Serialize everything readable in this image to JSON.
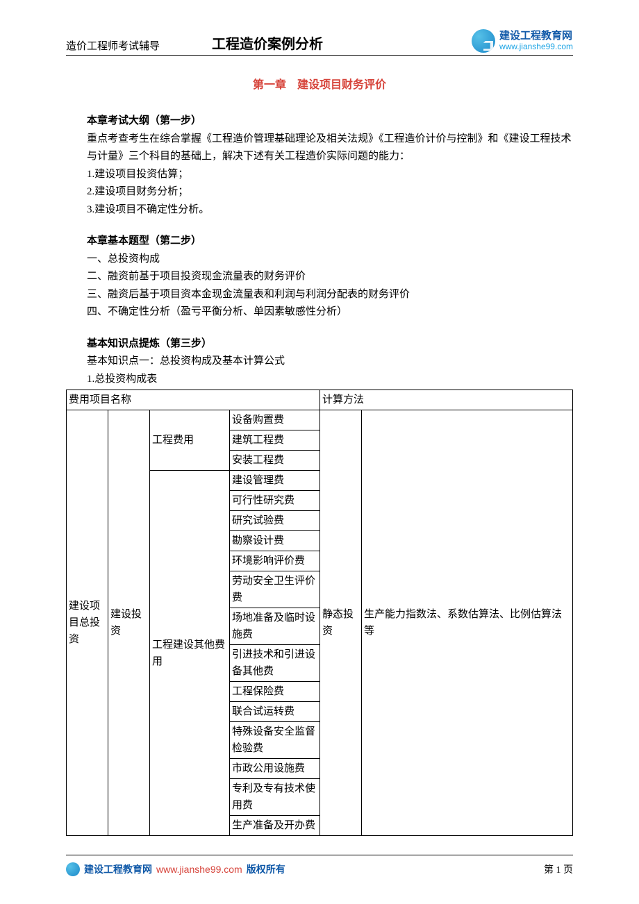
{
  "header": {
    "left": "造价工程师考试辅导",
    "center": "工程造价案例分析",
    "logo_cn": "建设工程教育网",
    "logo_url": "www.jianshe99.com"
  },
  "chapter_title": "第一章　建设项目财务评价",
  "sec1": {
    "head": "本章考试大纲（第一步）",
    "intro": "重点考查考生在综合掌握《工程造价管理基础理论及相关法规》《工程造价计价与控制》和《建设工程技术与计量》三个科目的基础上，解决下述有关工程造价实际问题的能力：",
    "i1": "1.建设项目投资估算；",
    "i2": "2.建设项目财务分析；",
    "i3": "3.建设项目不确定性分析。"
  },
  "sec2": {
    "head": "本章基本题型（第二步）",
    "i1": "一、总投资构成",
    "i2": "二、融资前基于项目投资现金流量表的财务评价",
    "i3": "三、融资后基于项目资本金现金流量表和利润与利润分配表的财务评价",
    "i4": "四、不确定性分析（盈亏平衡分析、单因素敏感性分析）"
  },
  "sec3": {
    "head": "基本知识点提炼（第三步）",
    "sub": "基本知识点一：总投资构成及基本计算公式",
    "tab_title": "1.总投资构成表"
  },
  "table": {
    "h1": "费用项目名称",
    "h2": "计算方法",
    "c1": "建设项目总投资",
    "c2": "建设投资",
    "c3a": "工程费用",
    "c3b": "工程建设其他费用",
    "c5": "静态投资",
    "c6": "生产能力指数法、系数估算法、比例估算法等",
    "r": [
      "设备购置费",
      "建筑工程费",
      "安装工程费",
      "建设管理费",
      "可行性研究费",
      "研究试验费",
      "勘察设计费",
      "环境影响评价费",
      "劳动安全卫生评价费",
      "场地准备及临时设施费",
      "引进技术和引进设备其他费",
      "工程保险费",
      "联合试运转费",
      "特殊设备安全监督检验费",
      "市政公用设施费",
      "专利及专有技术使用费",
      "生产准备及开办费"
    ]
  },
  "footer": {
    "site": "建设工程教育网",
    "url": "www.jianshe99.com",
    "copy": "版权所有",
    "page": "第 1 页"
  }
}
